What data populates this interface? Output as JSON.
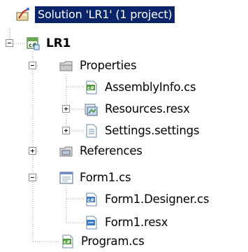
{
  "solution": {
    "label": "Solution 'LR1' (1 project)",
    "icon": "solution-icon"
  },
  "project": {
    "label": "LR1",
    "icon": "csharp-project-icon",
    "expanded": true
  },
  "items": [
    {
      "label": "Properties",
      "icon": "folder-icon",
      "expanded": true
    },
    {
      "label": "AssemblyInfo.cs",
      "icon": "csharp-file-icon"
    },
    {
      "label": "Resources.resx",
      "icon": "resources-icon",
      "expanded": false
    },
    {
      "label": "Settings.settings",
      "icon": "settings-file-icon",
      "expanded": false
    },
    {
      "label": "References",
      "icon": "references-icon",
      "expanded": false
    },
    {
      "label": "Form1.cs",
      "icon": "form-icon",
      "expanded": true
    },
    {
      "label": "Form1.Designer.cs",
      "icon": "csharp-file-icon"
    },
    {
      "label": "Form1.resx",
      "icon": "resx-file-icon"
    },
    {
      "label": "Program.cs",
      "icon": "csharp-file-icon"
    }
  ],
  "colors": {
    "selection_bg": "#0a246a",
    "selection_text": "#ffffff",
    "tree_line": "#a0a0a0",
    "expander_border": "#8e8f8f"
  }
}
